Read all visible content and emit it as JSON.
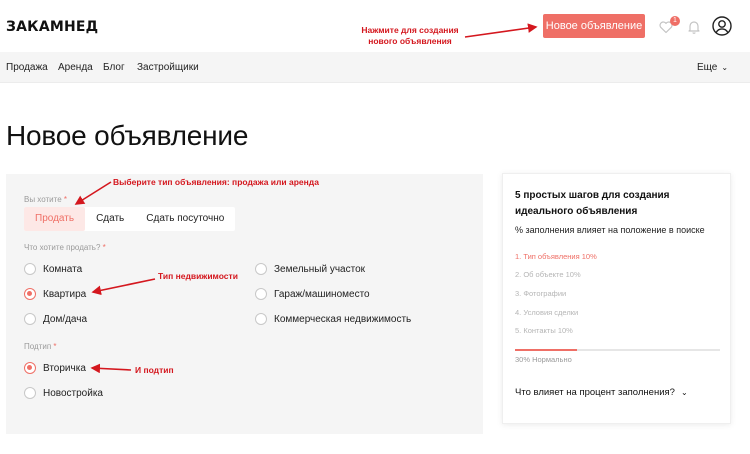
{
  "header": {
    "logo": "ЗАКАМНЕД",
    "new_ad_button": "Новое объявление",
    "favorites_count": "1",
    "icons": [
      "heart-icon",
      "bell-icon",
      "user-icon"
    ]
  },
  "nav": {
    "items": [
      "Продажа",
      "Аренда",
      "Блог",
      "Застройщики"
    ],
    "more": "Еще"
  },
  "page": {
    "title": "Новое объявление"
  },
  "form": {
    "want_label": "Вы хотите",
    "deal_types": [
      "Продать",
      "Сдать",
      "Сдать посуточно"
    ],
    "selected_deal_type": "Продать",
    "property_label": "Что хотите продать?",
    "property_types_left": [
      "Комната",
      "Квартира",
      "Дом/дача"
    ],
    "property_types_right": [
      "Земельный участок",
      "Гараж/машиноместо",
      "Коммерческая недвижимость"
    ],
    "selected_property_type": "Квартира",
    "subtype_label": "Подтип",
    "subtypes": [
      "Вторичка",
      "Новостройка"
    ],
    "selected_subtype": "Вторичка",
    "required_mark": "*"
  },
  "sidebar": {
    "title": "5 простых шагов для создания идеального объявления",
    "subtitle": "% заполнения влияет на положение в поиске",
    "steps": [
      "1. Тип объявления 10%",
      "2. Об объекте 10%",
      "3. Фотографии",
      "4. Условия сделки",
      "5. Контакты 10%"
    ],
    "active_step": 0,
    "progress_percent": 30,
    "progress_text": "30% Нормально",
    "faq": "Что влияет на процент заполнения?"
  },
  "annotations": {
    "new_ad": "Нажмите для создания нового объявления",
    "deal_type": "Выберите тип объявления: продажа или аренда",
    "property_type": "Тип недвижимости",
    "subtype": "И подтип"
  },
  "colors": {
    "accent": "#ef6f66",
    "annotation": "#d4171e"
  }
}
